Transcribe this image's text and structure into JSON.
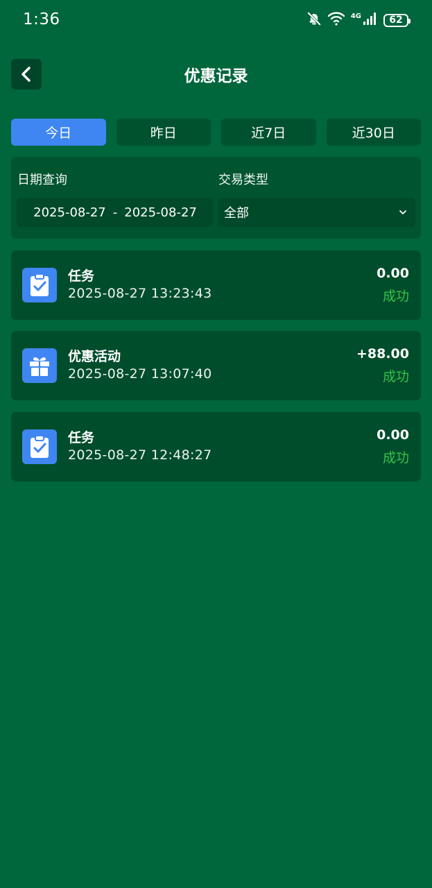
{
  "status_bar": {
    "time": "1:36",
    "battery": "62",
    "network": "4G"
  },
  "header": {
    "title": "优惠记录"
  },
  "tabs": [
    {
      "label": "今日",
      "active": true
    },
    {
      "label": "昨日",
      "active": false
    },
    {
      "label": "近7日",
      "active": false
    },
    {
      "label": "近30日",
      "active": false
    }
  ],
  "filter": {
    "date_label": "日期查询",
    "type_label": "交易类型",
    "start_date": "2025-08-27",
    "separator": "-",
    "end_date": "2025-08-27",
    "type_value": "全部"
  },
  "records": [
    {
      "icon": "clipboard-check-icon",
      "title": "任务",
      "time": "2025-08-27 13:23:43",
      "amount": "0.00",
      "status": "成功"
    },
    {
      "icon": "gift-icon",
      "title": "优惠活动",
      "time": "2025-08-27 13:07:40",
      "amount": "+88.00",
      "status": "成功"
    },
    {
      "icon": "clipboard-check-icon",
      "title": "任务",
      "time": "2025-08-27 12:48:27",
      "amount": "0.00",
      "status": "成功"
    }
  ],
  "colors": {
    "background": "#00663c",
    "accent": "#3f86f2",
    "success": "#36c24a",
    "card": "#004d2b"
  }
}
